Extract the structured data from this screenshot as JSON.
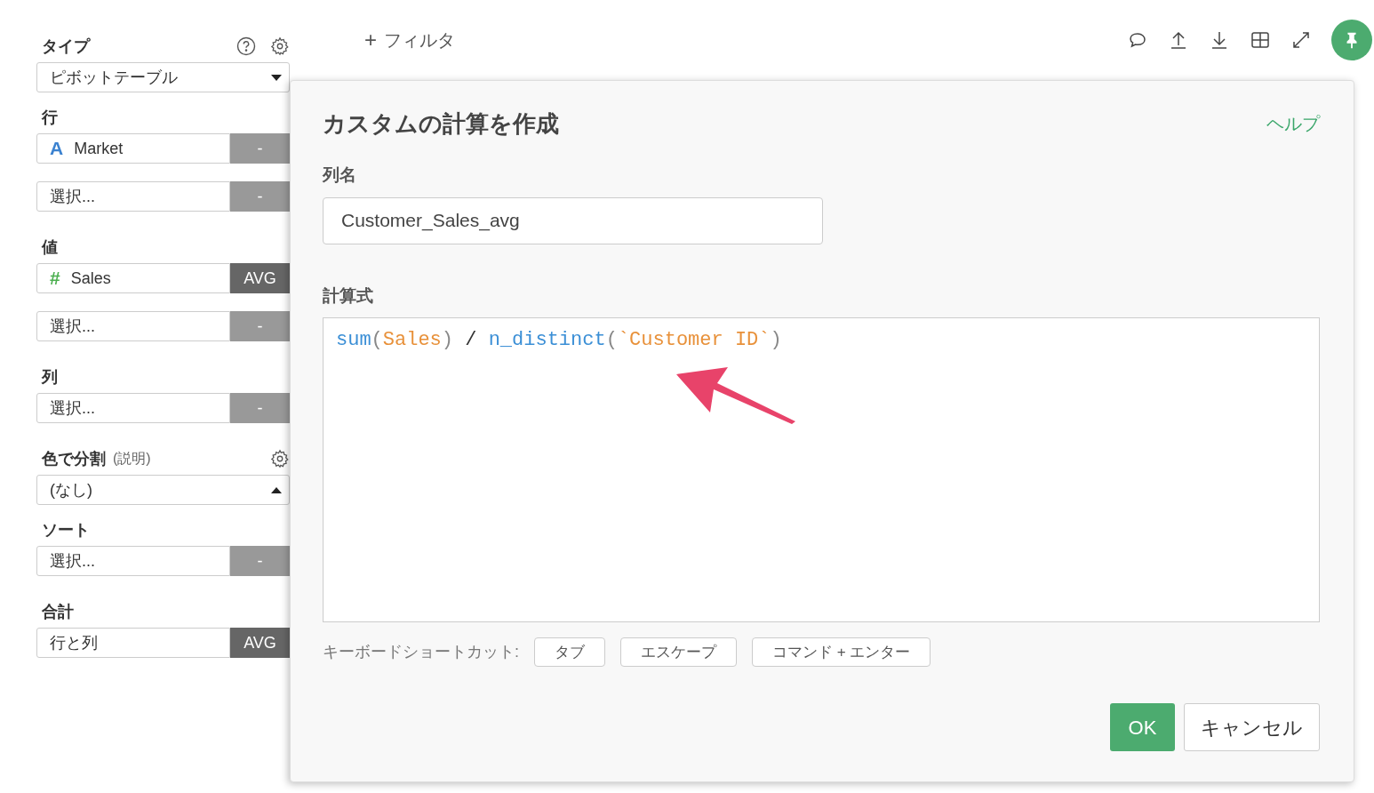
{
  "sidebar": {
    "sections": [
      {
        "title": "タイプ",
        "help_icon": true,
        "settings_icon": true,
        "controls": [
          {
            "kind": "select",
            "value": "ピボットテーブル",
            "expanded": false
          }
        ]
      },
      {
        "title": "行",
        "controls": [
          {
            "kind": "slot",
            "type_icon": "A",
            "color": "#3b82d0",
            "label": "Market",
            "action": "-",
            "active": false
          },
          {
            "kind": "slot",
            "label": "選択...",
            "action": "-",
            "active": false
          }
        ]
      },
      {
        "title": "値",
        "controls": [
          {
            "kind": "slot",
            "type_icon": "#",
            "color": "#4caf50",
            "label": "Sales",
            "action": "AVG",
            "active": true
          },
          {
            "kind": "slot",
            "label": "選択...",
            "action": "-",
            "active": false
          }
        ]
      },
      {
        "title": "列",
        "controls": [
          {
            "kind": "slot",
            "label": "選択...",
            "action": "-",
            "active": false
          }
        ]
      },
      {
        "title": "色で分割",
        "note": "(説明)",
        "help_icon": false,
        "settings_icon": true,
        "controls": [
          {
            "kind": "select",
            "value": "(なし)",
            "expanded": true
          }
        ]
      },
      {
        "title": "ソート",
        "controls": [
          {
            "kind": "slot",
            "label": "選択...",
            "action": "-",
            "active": false
          }
        ]
      },
      {
        "title": "合計",
        "controls": [
          {
            "kind": "slot",
            "label": "行と列",
            "action": "AVG",
            "active": true
          }
        ]
      }
    ]
  },
  "toolbar": {
    "filter_icon": "+",
    "filter_label": "フィルタ"
  },
  "dialog": {
    "title": "カスタムの計算を作成",
    "help_link": "ヘルプ",
    "name_label": "列名",
    "name_value": "Customer_Sales_avg",
    "formula_label": "計算式",
    "formula_tokens": [
      {
        "kind": "function",
        "text": "sum"
      },
      {
        "kind": "punct",
        "text": "("
      },
      {
        "kind": "field",
        "text": "Sales"
      },
      {
        "kind": "punct",
        "text": ")"
      },
      {
        "kind": "operator",
        "text": " / "
      },
      {
        "kind": "function",
        "text": "n_distinct"
      },
      {
        "kind": "punct",
        "text": "("
      },
      {
        "kind": "field",
        "text": "`Customer ID`"
      },
      {
        "kind": "punct",
        "text": ")"
      }
    ],
    "shortcuts_label": "キーボードショートカット:",
    "shortcuts": [
      "タブ",
      "エスケープ",
      "コマンド + エンター"
    ],
    "buttons": [
      {
        "kind": "primary",
        "label": "OK"
      },
      {
        "kind": "secondary",
        "label": "キャンセル"
      }
    ]
  }
}
